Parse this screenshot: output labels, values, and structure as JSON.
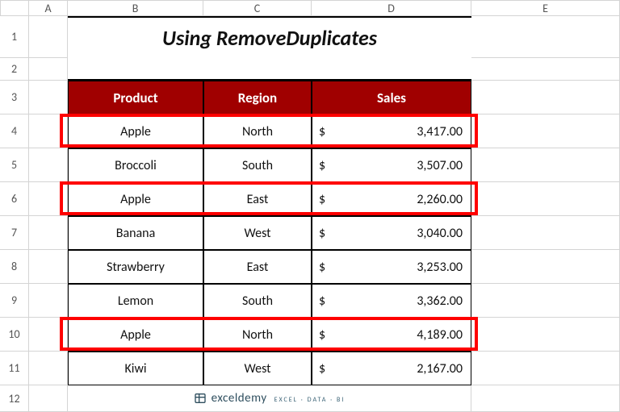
{
  "columns": [
    "A",
    "B",
    "C",
    "D",
    "E"
  ],
  "rows": [
    "1",
    "2",
    "3",
    "4",
    "5",
    "6",
    "7",
    "8",
    "9",
    "10",
    "11",
    "12"
  ],
  "title": "Using RemoveDuplicates",
  "headers": {
    "product": "Product",
    "region": "Region",
    "sales": "Sales"
  },
  "currency": "$",
  "data": [
    {
      "product": "Apple",
      "region": "North",
      "sales": "3,417.00",
      "hl": true
    },
    {
      "product": "Broccoli",
      "region": "South",
      "sales": "3,507.00",
      "hl": false
    },
    {
      "product": "Apple",
      "region": "East",
      "sales": "2,260.00",
      "hl": true
    },
    {
      "product": "Banana",
      "region": "West",
      "sales": "3,040.00",
      "hl": false
    },
    {
      "product": "Strawberry",
      "region": "East",
      "sales": "3,253.00",
      "hl": false
    },
    {
      "product": "Lemon",
      "region": "South",
      "sales": "3,362.00",
      "hl": false
    },
    {
      "product": "Apple",
      "region": "North",
      "sales": "4,189.00",
      "hl": true
    },
    {
      "product": "Kiwi",
      "region": "West",
      "sales": "2,167.00",
      "hl": false
    }
  ],
  "watermark": {
    "brand": "exceldemy",
    "tag": "EXCEL · DATA · BI"
  },
  "chart_data": {
    "type": "table",
    "title": "Using RemoveDuplicates",
    "columns": [
      "Product",
      "Region",
      "Sales"
    ],
    "rows": [
      [
        "Apple",
        "North",
        3417.0
      ],
      [
        "Broccoli",
        "South",
        3507.0
      ],
      [
        "Apple",
        "East",
        2260.0
      ],
      [
        "Banana",
        "West",
        3040.0
      ],
      [
        "Strawberry",
        "East",
        3253.0
      ],
      [
        "Lemon",
        "South",
        3362.0
      ],
      [
        "Apple",
        "North",
        4189.0
      ],
      [
        "Kiwi",
        "West",
        2167.0
      ]
    ],
    "highlighted_row_indices": [
      0,
      2,
      6
    ],
    "currency": "USD"
  }
}
